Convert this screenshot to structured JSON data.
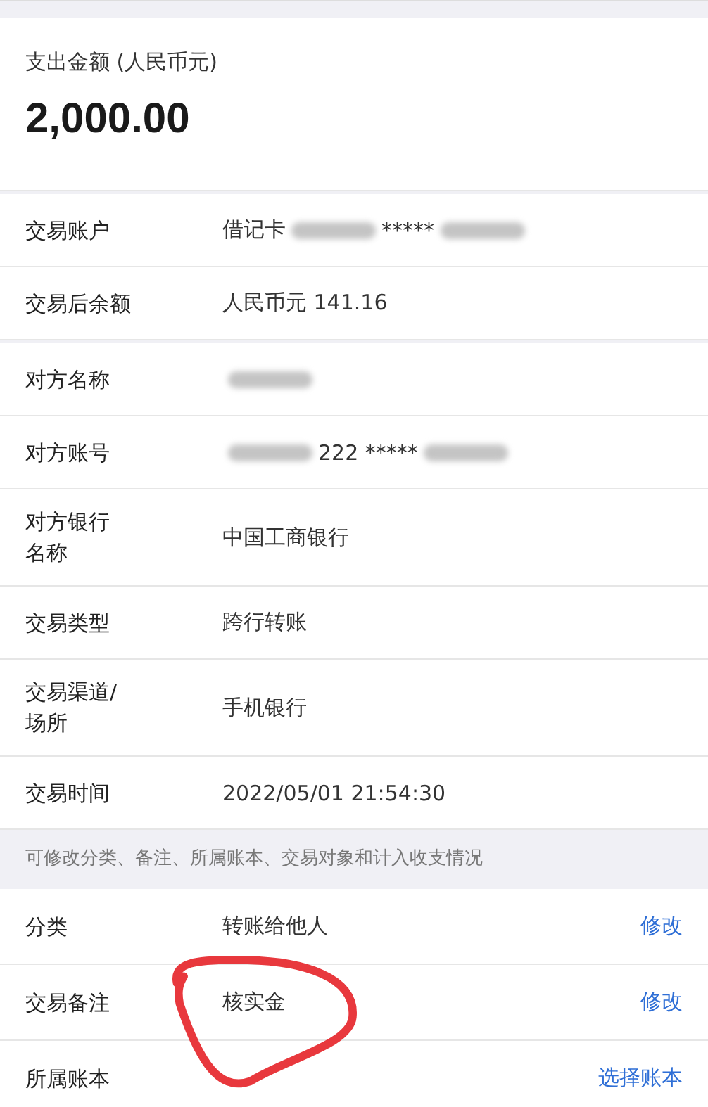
{
  "header": {
    "label": "支出金额 (人民币元)",
    "amount": "2,000.00"
  },
  "groups": [
    {
      "rows": [
        {
          "label": [
            "交易账户"
          ],
          "value": [
            {
              "kind": "text",
              "text": "借记卡"
            },
            {
              "kind": "blur"
            },
            {
              "kind": "text",
              "text": "*****"
            },
            {
              "kind": "blur"
            }
          ]
        },
        {
          "label": [
            "交易后余额"
          ],
          "value": [
            {
              "kind": "text",
              "text": "人民币元 141.16"
            }
          ]
        }
      ]
    },
    {
      "rows": [
        {
          "label": [
            "对方名称"
          ],
          "value": [
            {
              "kind": "blur"
            }
          ]
        },
        {
          "label": [
            "对方账号"
          ],
          "value": [
            {
              "kind": "blur"
            },
            {
              "kind": "text",
              "text": "222 *****"
            },
            {
              "kind": "blur"
            }
          ]
        },
        {
          "label": [
            "对方银行",
            "名称"
          ],
          "value": [
            {
              "kind": "text",
              "text": "中国工商银行"
            }
          ]
        },
        {
          "label": [
            "交易类型"
          ],
          "value": [
            {
              "kind": "text",
              "text": "跨行转账"
            }
          ]
        },
        {
          "label": [
            "交易渠道/",
            "场所"
          ],
          "value": [
            {
              "kind": "text",
              "text": "手机银行"
            }
          ]
        },
        {
          "label": [
            "交易时间"
          ],
          "value": [
            {
              "kind": "text",
              "text": "2022/05/01 21:54:30"
            }
          ]
        }
      ]
    }
  ],
  "notice": "可修改分类、备注、所属账本、交易对象和计入收支情况",
  "editable": [
    {
      "label": "分类",
      "value": "转账给他人",
      "action": "修改"
    },
    {
      "label": "交易备注",
      "value": "核实金",
      "action": "修改"
    },
    {
      "label": "所属账本",
      "action": "选择账本"
    }
  ]
}
